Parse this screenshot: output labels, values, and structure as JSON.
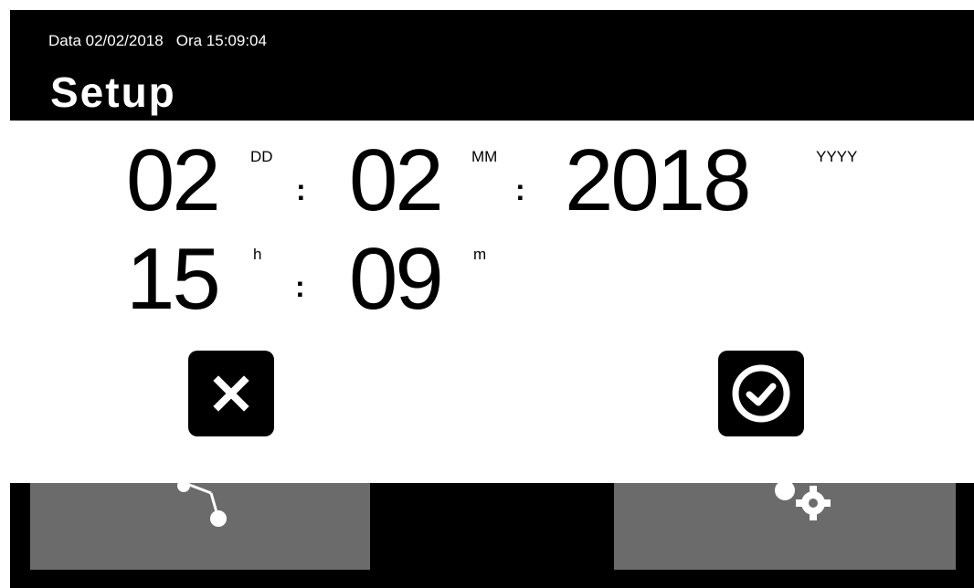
{
  "header": {
    "date_label": "Data 02/02/2018",
    "time_label": "Ora 15:09:04",
    "title": "Setup"
  },
  "datetime_dialog": {
    "day": {
      "value": "02",
      "unit": "DD"
    },
    "month": {
      "value": "02",
      "unit": "MM"
    },
    "year": {
      "value": "2018",
      "unit": "YYYY"
    },
    "hour": {
      "value": "15",
      "unit": "h"
    },
    "minute": {
      "value": "09",
      "unit": "m"
    },
    "separator": ":",
    "cancel_icon": "close-icon",
    "confirm_icon": "check-circle-icon"
  },
  "tiles": {
    "left_icon": "network-nodes-icon",
    "right_icon": "gears-icon"
  },
  "colors": {
    "background": "#000000",
    "dialog": "#ffffff",
    "tile": "#6b6b6b",
    "button": "#000000"
  }
}
